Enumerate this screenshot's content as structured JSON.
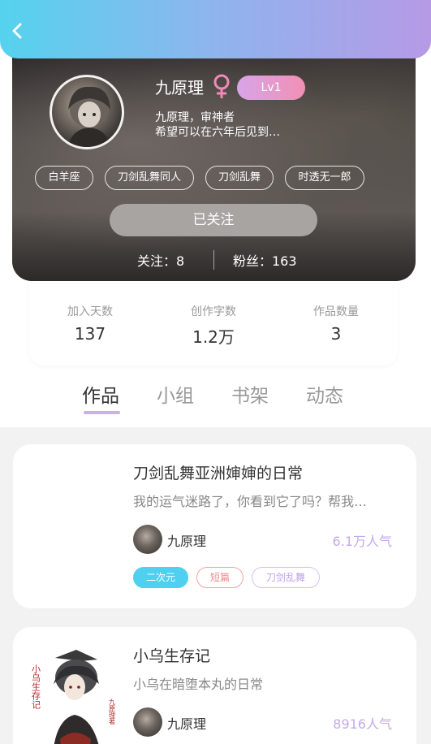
{
  "header": {
    "back_icon": "chevron-left-icon"
  },
  "profile": {
    "name": "九原理",
    "gender_icon": "female-icon",
    "level": "Lv1",
    "bio_line1": "九原理，审神者",
    "bio_line2": "希望可以在六年后见到…",
    "tags": [
      "白羊座",
      "刀剑乱舞同人",
      "刀剑乱舞",
      "时透无一郎"
    ],
    "follow_button": "已关注",
    "following": "关注：8",
    "fans": "粉丝：163"
  },
  "metrics": [
    {
      "label": "加入天数",
      "value": "137"
    },
    {
      "label": "创作字数",
      "value": "1.2万"
    },
    {
      "label": "作品数量",
      "value": "3"
    }
  ],
  "tabs": [
    {
      "label": "作品",
      "active": true
    },
    {
      "label": "小组",
      "active": false
    },
    {
      "label": "书架",
      "active": false
    },
    {
      "label": "动态",
      "active": false
    }
  ],
  "works": [
    {
      "title": "刀剑乱舞亚洲婶婶的日常",
      "desc": "我的运气迷路了，你看到它了吗？帮我…",
      "author": "九原理",
      "popularity": "6.1万人气",
      "tags": [
        "二次元",
        "短篇",
        "刀剑乱舞"
      ]
    },
    {
      "title": "小乌生存记",
      "desc": "小乌在暗堕本丸的日常",
      "author": "九原理",
      "popularity": "8916人气",
      "cover_text_left": "小乌生存记",
      "cover_text_right": "九原理著"
    }
  ],
  "colors": {
    "header_gradient": [
      "#55d3ee",
      "#b69ae6"
    ],
    "level_badge": [
      "#d8a5e8",
      "#f28fb5"
    ],
    "tab_underline": "#c8b3e9",
    "popularity": "#c4a9ea"
  }
}
